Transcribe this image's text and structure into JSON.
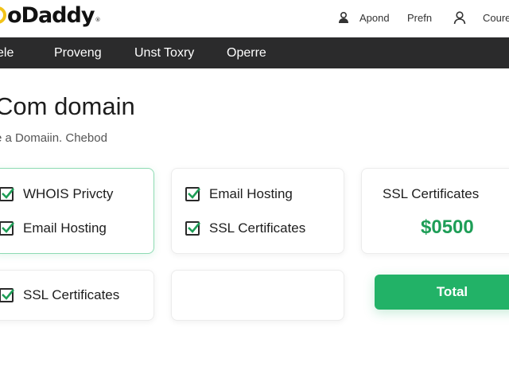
{
  "header": {
    "logo_text": "oDaddy",
    "logo_tm": "®",
    "links": {
      "apond": "Apond",
      "prefn": "Prefn",
      "coure": "Coure"
    }
  },
  "nav": {
    "items": [
      "ele",
      "Proveng",
      "Unst Toxry",
      "Operre"
    ]
  },
  "main": {
    "title": "Com domain",
    "subtitle": "e a Domaiin. Chebod"
  },
  "cards": {
    "card1": {
      "opt1": "WHOIS Privcty",
      "opt2": "Email Hosting"
    },
    "card2": {
      "opt1": "Email Hosting",
      "opt2": "SSL Certificates"
    },
    "card3": {
      "heading": "SSL Certificates",
      "price": "$0500"
    },
    "card4": {
      "opt1": "SSL Certificates"
    }
  },
  "total_label": "Total",
  "colors": {
    "accent": "#22b267",
    "price": "#1e9e57",
    "nav_bg": "#2b2b2c",
    "logo_ring": "#f2c318"
  },
  "icons": {
    "apond": "user-lock-icon",
    "account": "person-icon",
    "check": "check-icon"
  }
}
